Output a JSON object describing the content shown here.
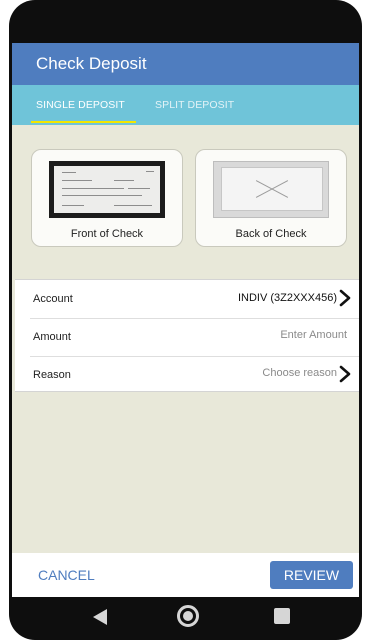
{
  "app": {
    "title": "Check Deposit"
  },
  "tabs": [
    {
      "label": "SINGLE DEPOSIT",
      "selected": true
    },
    {
      "label": "SPLIT DEPOSIT",
      "selected": false
    }
  ],
  "check_images": {
    "front_label": "Front of Check",
    "back_label": "Back of Check"
  },
  "form": {
    "account": {
      "label": "Account",
      "value": "INDIV (3Z2XXX456)"
    },
    "amount": {
      "label": "Amount",
      "placeholder": "Enter Amount"
    },
    "reason": {
      "label": "Reason",
      "placeholder": "Choose reason"
    }
  },
  "footer": {
    "cancel_label": "CANCEL",
    "review_label": "REVIEW"
  },
  "colors": {
    "header": "#4f7dbf",
    "tabbar": "#6fc4d9",
    "tab_indicator": "#f2e600",
    "background": "#e8e8d9"
  },
  "icons": {
    "row_chevron": "chevron-right-icon",
    "nav_back": "nav-back-icon",
    "nav_home": "nav-home-icon",
    "nav_recent": "nav-recent-apps-icon"
  }
}
